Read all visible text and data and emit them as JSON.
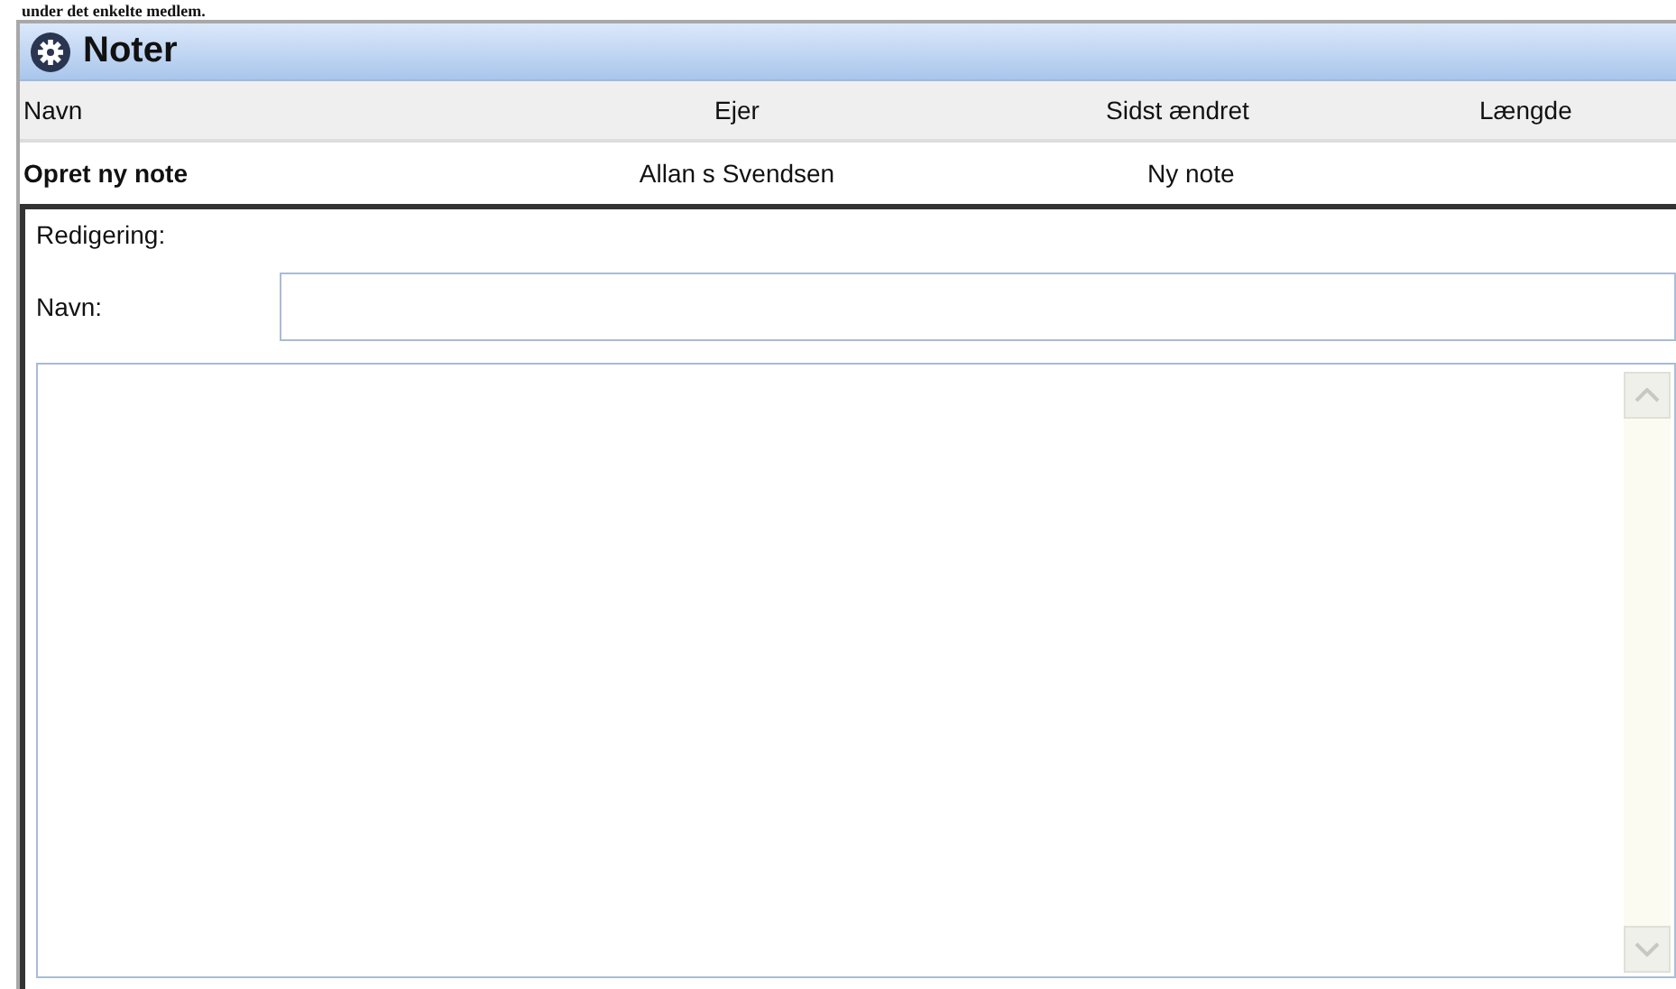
{
  "top_text": "under det enkelte medlem.",
  "panel": {
    "title": "Noter"
  },
  "table": {
    "columns": [
      "Navn",
      "Ejer",
      "Sidst ændret",
      "Længde"
    ],
    "rows": [
      {
        "cells": [
          "Opret ny note",
          "Allan s Svendsen",
          "Ny note"
        ]
      }
    ]
  },
  "editor": {
    "section_label": "Redigering:",
    "name_label": "Navn:"
  }
}
